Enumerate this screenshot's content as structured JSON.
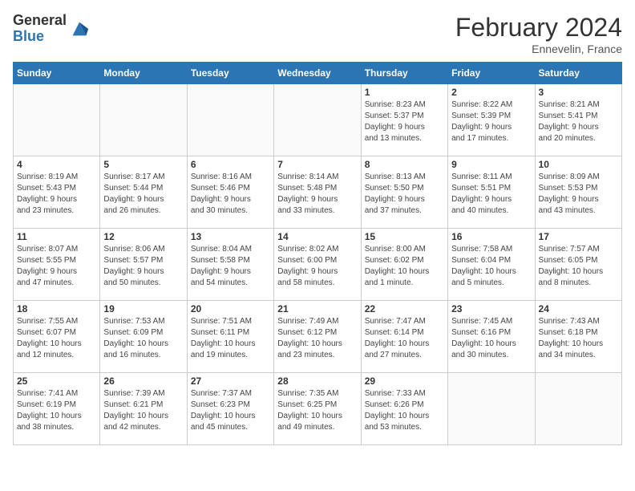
{
  "logo": {
    "general": "General",
    "blue": "Blue"
  },
  "title": "February 2024",
  "subtitle": "Ennevelin, France",
  "days_of_week": [
    "Sunday",
    "Monday",
    "Tuesday",
    "Wednesday",
    "Thursday",
    "Friday",
    "Saturday"
  ],
  "weeks": [
    [
      {
        "day": "",
        "info": ""
      },
      {
        "day": "",
        "info": ""
      },
      {
        "day": "",
        "info": ""
      },
      {
        "day": "",
        "info": ""
      },
      {
        "day": "1",
        "info": "Sunrise: 8:23 AM\nSunset: 5:37 PM\nDaylight: 9 hours\nand 13 minutes."
      },
      {
        "day": "2",
        "info": "Sunrise: 8:22 AM\nSunset: 5:39 PM\nDaylight: 9 hours\nand 17 minutes."
      },
      {
        "day": "3",
        "info": "Sunrise: 8:21 AM\nSunset: 5:41 PM\nDaylight: 9 hours\nand 20 minutes."
      }
    ],
    [
      {
        "day": "4",
        "info": "Sunrise: 8:19 AM\nSunset: 5:43 PM\nDaylight: 9 hours\nand 23 minutes."
      },
      {
        "day": "5",
        "info": "Sunrise: 8:17 AM\nSunset: 5:44 PM\nDaylight: 9 hours\nand 26 minutes."
      },
      {
        "day": "6",
        "info": "Sunrise: 8:16 AM\nSunset: 5:46 PM\nDaylight: 9 hours\nand 30 minutes."
      },
      {
        "day": "7",
        "info": "Sunrise: 8:14 AM\nSunset: 5:48 PM\nDaylight: 9 hours\nand 33 minutes."
      },
      {
        "day": "8",
        "info": "Sunrise: 8:13 AM\nSunset: 5:50 PM\nDaylight: 9 hours\nand 37 minutes."
      },
      {
        "day": "9",
        "info": "Sunrise: 8:11 AM\nSunset: 5:51 PM\nDaylight: 9 hours\nand 40 minutes."
      },
      {
        "day": "10",
        "info": "Sunrise: 8:09 AM\nSunset: 5:53 PM\nDaylight: 9 hours\nand 43 minutes."
      }
    ],
    [
      {
        "day": "11",
        "info": "Sunrise: 8:07 AM\nSunset: 5:55 PM\nDaylight: 9 hours\nand 47 minutes."
      },
      {
        "day": "12",
        "info": "Sunrise: 8:06 AM\nSunset: 5:57 PM\nDaylight: 9 hours\nand 50 minutes."
      },
      {
        "day": "13",
        "info": "Sunrise: 8:04 AM\nSunset: 5:58 PM\nDaylight: 9 hours\nand 54 minutes."
      },
      {
        "day": "14",
        "info": "Sunrise: 8:02 AM\nSunset: 6:00 PM\nDaylight: 9 hours\nand 58 minutes."
      },
      {
        "day": "15",
        "info": "Sunrise: 8:00 AM\nSunset: 6:02 PM\nDaylight: 10 hours\nand 1 minute."
      },
      {
        "day": "16",
        "info": "Sunrise: 7:58 AM\nSunset: 6:04 PM\nDaylight: 10 hours\nand 5 minutes."
      },
      {
        "day": "17",
        "info": "Sunrise: 7:57 AM\nSunset: 6:05 PM\nDaylight: 10 hours\nand 8 minutes."
      }
    ],
    [
      {
        "day": "18",
        "info": "Sunrise: 7:55 AM\nSunset: 6:07 PM\nDaylight: 10 hours\nand 12 minutes."
      },
      {
        "day": "19",
        "info": "Sunrise: 7:53 AM\nSunset: 6:09 PM\nDaylight: 10 hours\nand 16 minutes."
      },
      {
        "day": "20",
        "info": "Sunrise: 7:51 AM\nSunset: 6:11 PM\nDaylight: 10 hours\nand 19 minutes."
      },
      {
        "day": "21",
        "info": "Sunrise: 7:49 AM\nSunset: 6:12 PM\nDaylight: 10 hours\nand 23 minutes."
      },
      {
        "day": "22",
        "info": "Sunrise: 7:47 AM\nSunset: 6:14 PM\nDaylight: 10 hours\nand 27 minutes."
      },
      {
        "day": "23",
        "info": "Sunrise: 7:45 AM\nSunset: 6:16 PM\nDaylight: 10 hours\nand 30 minutes."
      },
      {
        "day": "24",
        "info": "Sunrise: 7:43 AM\nSunset: 6:18 PM\nDaylight: 10 hours\nand 34 minutes."
      }
    ],
    [
      {
        "day": "25",
        "info": "Sunrise: 7:41 AM\nSunset: 6:19 PM\nDaylight: 10 hours\nand 38 minutes."
      },
      {
        "day": "26",
        "info": "Sunrise: 7:39 AM\nSunset: 6:21 PM\nDaylight: 10 hours\nand 42 minutes."
      },
      {
        "day": "27",
        "info": "Sunrise: 7:37 AM\nSunset: 6:23 PM\nDaylight: 10 hours\nand 45 minutes."
      },
      {
        "day": "28",
        "info": "Sunrise: 7:35 AM\nSunset: 6:25 PM\nDaylight: 10 hours\nand 49 minutes."
      },
      {
        "day": "29",
        "info": "Sunrise: 7:33 AM\nSunset: 6:26 PM\nDaylight: 10 hours\nand 53 minutes."
      },
      {
        "day": "",
        "info": ""
      },
      {
        "day": "",
        "info": ""
      }
    ]
  ]
}
